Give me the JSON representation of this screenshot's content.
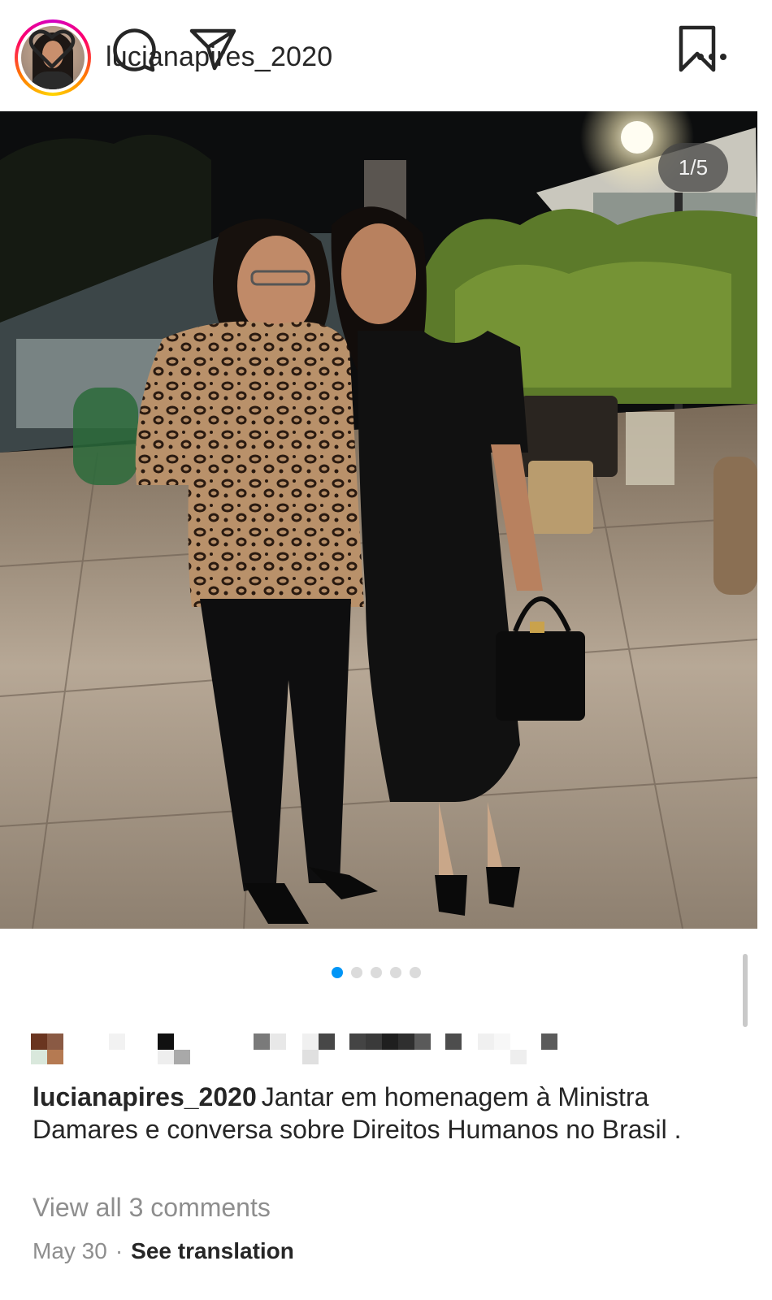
{
  "post": {
    "username": "lucianapires_2020",
    "slide_counter": "1/5",
    "total_slides": 5,
    "active_slide": 1,
    "caption_text": "Jantar em homenagem à Ministra Damares e conversa sobre Direitos Humanos  no Brasil .",
    "view_comments_label": "View all 3 comments",
    "date": "May 30",
    "separator": "·",
    "see_translation_label": "See translation"
  },
  "icons": {
    "more": "more-horizontal-icon",
    "like": "heart-icon",
    "comment": "comment-bubble-icon",
    "share": "send-paper-plane-icon",
    "save": "bookmark-icon"
  },
  "colors": {
    "accent_blue": "#0095f6",
    "text_primary": "#262626",
    "text_secondary": "#8e8e8e",
    "dot_inactive": "#dbdbdb"
  }
}
